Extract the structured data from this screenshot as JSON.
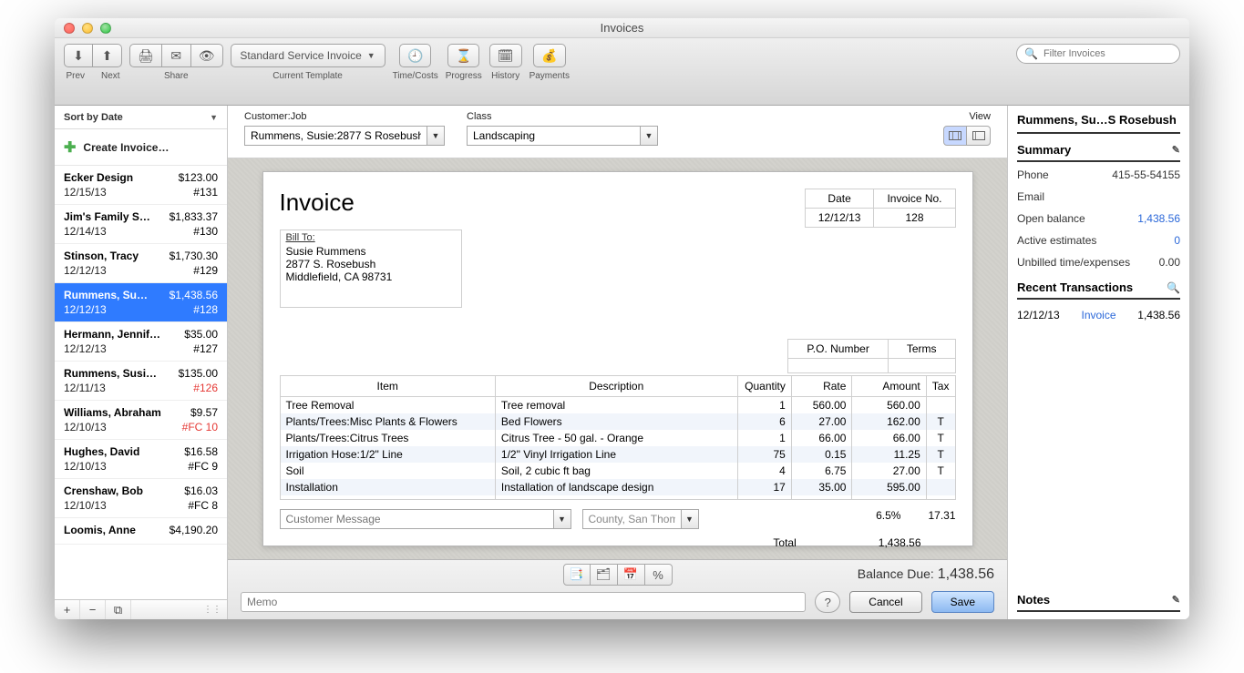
{
  "window": {
    "title": "Invoices"
  },
  "toolbar": {
    "prev": "Prev",
    "next": "Next",
    "share": "Share",
    "template_selected": "Standard Service Invoice",
    "template_label": "Current Template",
    "timecosts": "Time/Costs",
    "progress": "Progress",
    "history": "History",
    "payments": "Payments",
    "search_placeholder": "Filter Invoices"
  },
  "sidebar": {
    "sort_label": "Sort by Date",
    "create_label": "Create Invoice…",
    "footer": {
      "plus": "+",
      "minus": "−"
    },
    "items": [
      {
        "name": "Ecker Design",
        "amount": "$123.00",
        "date": "12/15/13",
        "num": "#131"
      },
      {
        "name": "Jim's Family S…",
        "amount": "$1,833.37",
        "date": "12/14/13",
        "num": "#130"
      },
      {
        "name": "Stinson, Tracy",
        "amount": "$1,730.30",
        "date": "12/12/13",
        "num": "#129"
      },
      {
        "name": "Rummens, Su…",
        "amount": "$1,438.56",
        "date": "12/12/13",
        "num": "#128",
        "selected": true
      },
      {
        "name": "Hermann, Jennif…",
        "amount": "$35.00",
        "date": "12/12/13",
        "num": "#127"
      },
      {
        "name": "Rummens, Susi…",
        "amount": "$135.00",
        "date": "12/11/13",
        "num": "#126",
        "num_red": true
      },
      {
        "name": "Williams, Abraham",
        "amount": "$9.57",
        "date": "12/10/13",
        "num": "#FC 10",
        "num_red": true
      },
      {
        "name": "Hughes, David",
        "amount": "$16.58",
        "date": "12/10/13",
        "num": "#FC 9"
      },
      {
        "name": "Crenshaw, Bob",
        "amount": "$16.03",
        "date": "12/10/13",
        "num": "#FC 8"
      },
      {
        "name": "Loomis, Anne",
        "amount": "$4,190.20",
        "date": "",
        "num": ""
      }
    ]
  },
  "top": {
    "customer_job_label": "Customer:Job",
    "customer_job_value": "Rummens, Susie:2877 S Rosebush",
    "class_label": "Class",
    "class_value": "Landscaping",
    "view_label": "View"
  },
  "doc": {
    "heading": "Invoice",
    "billto_label": "Bill To:",
    "billto_lines": [
      "Susie Rummens",
      "2877 S. Rosebush",
      "Middlefield, CA  98731"
    ],
    "meta": {
      "date_hdr": "Date",
      "invno_hdr": "Invoice No.",
      "date": "12/12/13",
      "invno": "128"
    },
    "po": {
      "po_hdr": "P.O. Number",
      "terms_hdr": "Terms",
      "po": "",
      "terms": ""
    },
    "cols": {
      "item": "Item",
      "desc": "Description",
      "qty": "Quantity",
      "rate": "Rate",
      "amt": "Amount",
      "tax": "Tax"
    },
    "lines": [
      {
        "item": "Tree Removal",
        "desc": "Tree removal",
        "qty": "1",
        "rate": "560.00",
        "amt": "560.00",
        "tax": ""
      },
      {
        "item": "Plants/Trees:Misc Plants & Flowers",
        "desc": "Bed Flowers",
        "qty": "6",
        "rate": "27.00",
        "amt": "162.00",
        "tax": "T"
      },
      {
        "item": "Plants/Trees:Citrus Trees",
        "desc": "Citrus Tree - 50 gal. - Orange",
        "qty": "1",
        "rate": "66.00",
        "amt": "66.00",
        "tax": "T"
      },
      {
        "item": "Irrigation Hose:1/2\" Line",
        "desc": "1/2\"  Vinyl Irrigation Line",
        "qty": "75",
        "rate": "0.15",
        "amt": "11.25",
        "tax": "T"
      },
      {
        "item": "Soil",
        "desc": "Soil, 2 cubic ft bag",
        "qty": "4",
        "rate": "6.75",
        "amt": "27.00",
        "tax": "T"
      },
      {
        "item": "Installation",
        "desc": "Installation of landscape design",
        "qty": "17",
        "rate": "35.00",
        "amt": "595.00",
        "tax": ""
      },
      {
        "item": "",
        "desc": "",
        "qty": "",
        "rate": "",
        "amt": "",
        "tax": ""
      }
    ],
    "cust_msg_placeholder": "Customer Message",
    "tax_item": "County, San Thomas",
    "tax_rate": "6.5%",
    "tax_amt": "17.31",
    "total_label": "Total",
    "total_amt": "1,438.56"
  },
  "bottom": {
    "balance_label": "Balance Due:",
    "balance": "1,438.56",
    "memo_placeholder": "Memo",
    "help": "?",
    "cancel": "Cancel",
    "save": "Save",
    "percent": "%"
  },
  "right": {
    "customer": "Rummens, Su…S Rosebush",
    "summary": "Summary",
    "phone_label": "Phone",
    "phone": "415-55-54155",
    "email_label": "Email",
    "openbal_label": "Open balance",
    "openbal": "1,438.56",
    "activeest_label": "Active estimates",
    "activeest": "0",
    "unbilled_label": "Unbilled time/expenses",
    "unbilled": "0.00",
    "recent": "Recent Transactions",
    "trx_date": "12/12/13",
    "trx_type": "Invoice",
    "trx_amt": "1,438.56",
    "notes": "Notes"
  }
}
